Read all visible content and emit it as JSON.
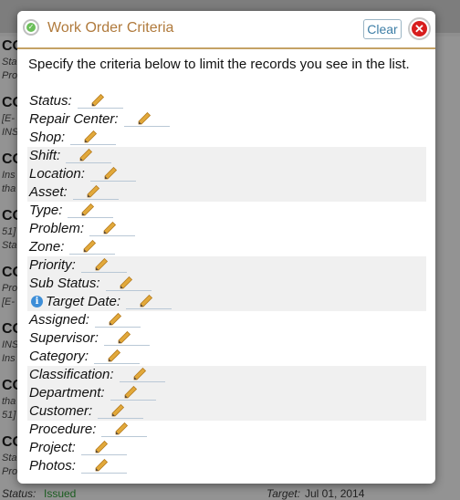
{
  "background": {
    "record_title": "CO",
    "record_lines": [
      "Sta",
      "Pro",
      "[E-",
      "INS",
      "Ins",
      "tha",
      "51]"
    ],
    "bottom": {
      "status_label": "Status:",
      "status_value": "Issued",
      "target_label": "Target:",
      "target_value": "Jul 01, 2014"
    }
  },
  "dialog": {
    "title": "Work Order Criteria",
    "clear_label": "Clear",
    "close_glyph": "✕",
    "intro": "Specify the criteria below to limit the records you see in the list.",
    "criteria": [
      {
        "label": "Status:",
        "shaded": false
      },
      {
        "label": "Repair Center:",
        "shaded": false
      },
      {
        "label": "Shop:",
        "shaded": false
      },
      {
        "label": "Shift:",
        "shaded": true
      },
      {
        "label": "Location:",
        "shaded": true
      },
      {
        "label": "Asset:",
        "shaded": true
      },
      {
        "label": "Type:",
        "shaded": false
      },
      {
        "label": "Problem:",
        "shaded": false
      },
      {
        "label": "Zone:",
        "shaded": false
      },
      {
        "label": "Priority:",
        "shaded": true
      },
      {
        "label": "Sub Status:",
        "shaded": true
      },
      {
        "label": "Target Date:",
        "shaded": true,
        "info": true
      },
      {
        "label": "Assigned:",
        "shaded": false
      },
      {
        "label": "Supervisor:",
        "shaded": false
      },
      {
        "label": "Category:",
        "shaded": false
      },
      {
        "label": "Classification:",
        "shaded": true
      },
      {
        "label": "Department:",
        "shaded": true
      },
      {
        "label": "Customer:",
        "shaded": true
      },
      {
        "label": "Procedure:",
        "shaded": false
      },
      {
        "label": "Project:",
        "shaded": false
      },
      {
        "label": "Photos:",
        "shaded": false
      }
    ],
    "info_glyph": "i",
    "colors": {
      "title": "#b07a3c",
      "header_rule": "#c4a265",
      "clear_text": "#3d7ea6",
      "close_red": "#d81e1e",
      "pencil": "#e2a93b",
      "info_blue": "#3d8ed8"
    }
  }
}
